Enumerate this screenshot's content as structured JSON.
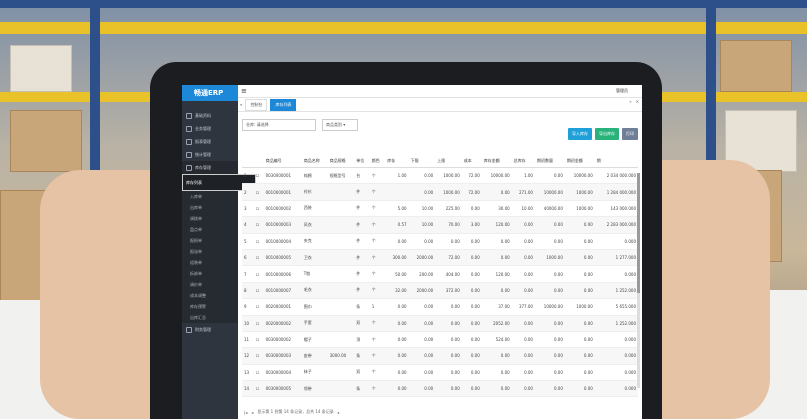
{
  "app": {
    "logo": "畅通ERP"
  },
  "sidebar": {
    "items": [
      {
        "label": "基础资料",
        "arrow": "‹"
      },
      {
        "label": "业务管理",
        "arrow": "‹"
      },
      {
        "label": "报表管理",
        "arrow": "‹"
      },
      {
        "label": "统计管理",
        "arrow": "‹"
      },
      {
        "label": "库存管理",
        "arrow": "⌄"
      }
    ],
    "sub_items": [
      "库存列表",
      "入库单",
      "出库单",
      "调拨单",
      "盘点单",
      "报损单",
      "报溢单",
      "组装单",
      "拆卸单",
      "调价单",
      "成本调整",
      "库存预警",
      "出库汇总"
    ],
    "bottom": {
      "label": "财务管理",
      "arrow": "‹"
    }
  },
  "topbar": {
    "menu_icon": "≡",
    "user": "管理员"
  },
  "tabs": [
    {
      "label": "控制台"
    },
    {
      "label": "库存列表"
    }
  ],
  "filters": {
    "warehouse": "仓库: 请选择",
    "category": "商品类别 ▾"
  },
  "buttons": [
    "导入库存",
    "导出库存",
    "打印"
  ],
  "table": {
    "headers": [
      "",
      "",
      "商品编号",
      "商品名称",
      "商品规格",
      "单位",
      "颜色",
      "库存",
      "下限",
      "上限",
      "成本",
      "库存金额",
      "总库存",
      "期初数量",
      "期初金额",
      "期"
    ],
    "rows": [
      {
        "n": "1",
        "code": "0030000001",
        "name": "纯棉",
        "spec": "规格型号",
        "unit": "台",
        "c": "个",
        "qty": "1.00",
        "low": "0.00",
        "high": "1000.00",
        "cost": "72.00",
        "amt": "10000.00",
        "total": "1.00",
        "q0": "0.00",
        "a0": "10000.00",
        "x": "2 034 000.000"
      },
      {
        "n": "2",
        "code": "0010000001",
        "name": "衬衫",
        "spec": "",
        "unit": "件",
        "c": "个",
        "qty": "",
        "low": "0.00",
        "high": "1000.00",
        "cost": "72.00",
        "amt": "0.00",
        "total": "271.00",
        "q0": "10000.00",
        "a0": "1000.00",
        "x": "1 284 000.000"
      },
      {
        "n": "3",
        "code": "0010000002",
        "name": "西装",
        "spec": "",
        "unit": "件",
        "c": "个",
        "qty": "5.00",
        "low": "10.00",
        "high": "225.00",
        "cost": "0.00",
        "amt": "30.00",
        "total": "10.00",
        "q0": "40000.00",
        "a0": "1000.00",
        "x": "143 000.000"
      },
      {
        "n": "4",
        "code": "0010000003",
        "name": "风衣",
        "spec": "",
        "unit": "件",
        "c": "个",
        "qty": "0.57",
        "low": "10.00",
        "high": "70.00",
        "cost": "3.00",
        "amt": "120.00",
        "total": "0.00",
        "q0": "0.00",
        "a0": "0.00",
        "x": "2 283 000.000"
      },
      {
        "n": "5",
        "code": "0010000004",
        "name": "夹克",
        "spec": "",
        "unit": "件",
        "c": "个",
        "qty": "0.00",
        "low": "0.00",
        "high": "0.00",
        "cost": "0.00",
        "amt": "0.00",
        "total": "0.00",
        "q0": "0.00",
        "a0": "0.00",
        "x": "0.000"
      },
      {
        "n": "6",
        "code": "0010000005",
        "name": "卫衣",
        "spec": "",
        "unit": "件",
        "c": "个",
        "qty": "300.00",
        "low": "2000.00",
        "high": "72.00",
        "cost": "0.00",
        "amt": "0.00",
        "total": "0.00",
        "q0": "1000.00",
        "a0": "0.00",
        "x": "1 277.000"
      },
      {
        "n": "7",
        "code": "0010000006",
        "name": "T恤",
        "spec": "",
        "unit": "件",
        "c": "个",
        "qty": "50.00",
        "low": "200.00",
        "high": "404.00",
        "cost": "0.00",
        "amt": "120.00",
        "total": "0.00",
        "q0": "0.00",
        "a0": "0.00",
        "x": "0.000"
      },
      {
        "n": "8",
        "code": "0010000007",
        "name": "毛衣",
        "spec": "",
        "unit": "件",
        "c": "个",
        "qty": "32.00",
        "low": "2000.00",
        "high": "372.00",
        "cost": "0.00",
        "amt": "0.00",
        "total": "0.00",
        "q0": "0.00",
        "a0": "0.00",
        "x": "1 252.000"
      },
      {
        "n": "9",
        "code": "0020000001",
        "name": "围巾",
        "spec": "",
        "unit": "条",
        "c": "1",
        "qty": "0.00",
        "low": "0.00",
        "high": "0.00",
        "cost": "0.00",
        "amt": "37.00",
        "total": "377.00",
        "q0": "10000.00",
        "a0": "1000.00",
        "x": "5 655.000"
      },
      {
        "n": "10",
        "code": "0020000002",
        "name": "手套",
        "spec": "",
        "unit": "双",
        "c": "个",
        "qty": "0.00",
        "low": "0.00",
        "high": "0.00",
        "cost": "0.00",
        "amt": "2052.00",
        "total": "0.00",
        "q0": "0.00",
        "a0": "0.00",
        "x": "1 252.000"
      },
      {
        "n": "11",
        "code": "0030000002",
        "name": "帽子",
        "spec": "",
        "unit": "顶",
        "c": "个",
        "qty": "0.00",
        "low": "0.00",
        "high": "0.00",
        "cost": "0.00",
        "amt": "524.00",
        "total": "0.00",
        "q0": "0.00",
        "a0": "0.00",
        "x": "0.000"
      },
      {
        "n": "12",
        "code": "0030000003",
        "name": "皮带",
        "spec": "3000.00",
        "unit": "条",
        "c": "个",
        "qty": "0.00",
        "low": "0.00",
        "high": "0.00",
        "cost": "0.00",
        "amt": "0.00",
        "total": "0.00",
        "q0": "0.00",
        "a0": "0.00",
        "x": "0.000"
      },
      {
        "n": "13",
        "code": "0030000004",
        "name": "袜子",
        "spec": "",
        "unit": "双",
        "c": "个",
        "qty": "0.00",
        "low": "0.00",
        "high": "0.00",
        "cost": "0.00",
        "amt": "0.00",
        "total": "0.00",
        "q0": "0.00",
        "a0": "0.00",
        "x": "0.000"
      },
      {
        "n": "14",
        "code": "0030000005",
        "name": "领带",
        "spec": "",
        "unit": "条",
        "c": "个",
        "qty": "0.00",
        "low": "0.00",
        "high": "0.00",
        "cost": "0.00",
        "amt": "0.00",
        "total": "0.00",
        "q0": "0.00",
        "a0": "0.00",
        "x": "0.000"
      }
    ]
  },
  "pager": {
    "text": "显示第 1 到第 14 条记录，总共 14 条记录"
  },
  "colors": {
    "accent": "#1e88d8",
    "sidebar": "#2f353e",
    "btn_green": "#2ab27b",
    "btn_blue": "#1fa0d8",
    "btn_gray": "#6f7f99"
  }
}
